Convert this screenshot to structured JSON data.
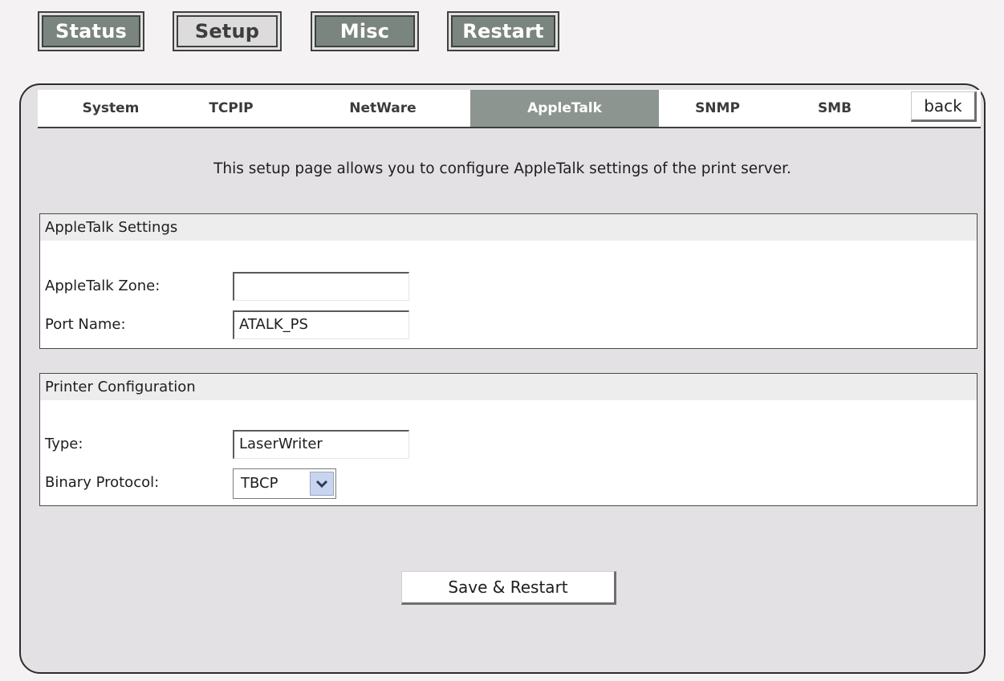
{
  "topnav": {
    "status": "Status",
    "setup": "Setup",
    "misc": "Misc",
    "restart": "Restart"
  },
  "tabs": {
    "system": "System",
    "tcpip": "TCPIP",
    "netware": "NetWare",
    "appletalk": "AppleTalk",
    "snmp": "SNMP",
    "smb": "SMB",
    "active": "AppleTalk",
    "back": "back"
  },
  "intro": "This setup page allows you to configure AppleTalk settings of the print server.",
  "appletalk_settings": {
    "title": "AppleTalk Settings",
    "zone_label": "AppleTalk Zone:",
    "zone_value": "",
    "port_label": "Port Name:",
    "port_value": "ATALK_PS"
  },
  "printer_config": {
    "title": "Printer Configuration",
    "type_label": "Type:",
    "type_value": "LaserWriter",
    "protocol_label": "Binary Protocol:",
    "protocol_value": "TBCP"
  },
  "save_button": "Save & Restart",
  "colors": {
    "active_tab": "#8c9590",
    "top_button_dark": "#7b857f",
    "panel_background": "#e4e1e4"
  },
  "icons": {
    "dropdown": "chevron-down-icon"
  }
}
